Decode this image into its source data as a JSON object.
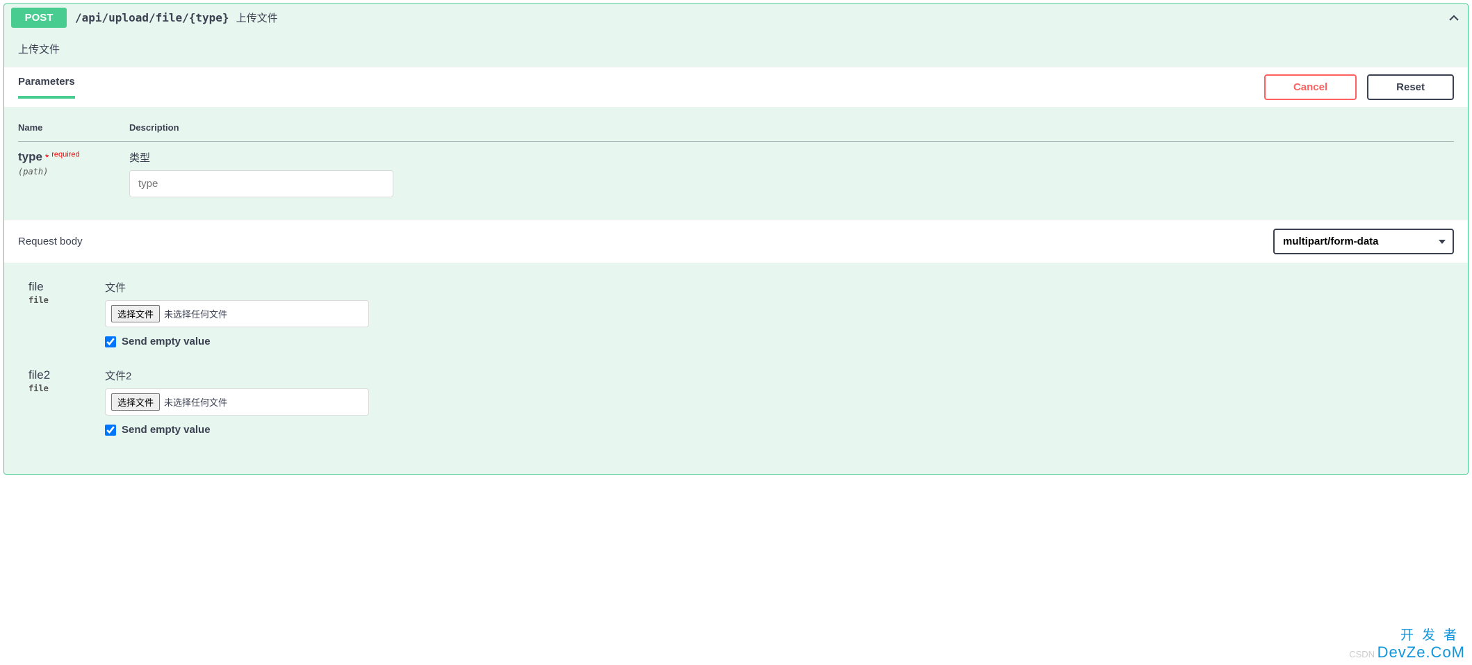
{
  "summary": {
    "method": "POST",
    "path": "/api/upload/file/{type}",
    "description": "上传文件"
  },
  "opblock_description": "上传文件",
  "parameters_tab": "Parameters",
  "buttons": {
    "cancel": "Cancel",
    "reset": "Reset"
  },
  "params_header": {
    "name": "Name",
    "description": "Description"
  },
  "params": [
    {
      "name": "type",
      "required_label": "required",
      "in": "(path)",
      "description": "类型",
      "placeholder": "type"
    }
  ],
  "request_body": {
    "title": "Request body",
    "content_type": "multipart/form-data"
  },
  "body_params": [
    {
      "name": "file",
      "type": "file",
      "description": "文件",
      "file_button": "选择文件",
      "file_status": "未选择任何文件",
      "send_empty_label": "Send empty value",
      "send_empty_checked": true
    },
    {
      "name": "file2",
      "type": "file",
      "description": "文件2",
      "file_button": "选择文件",
      "file_status": "未选择任何文件",
      "send_empty_label": "Send empty value",
      "send_empty_checked": true
    }
  ],
  "watermark": {
    "top": "开发者",
    "csdn": "CSDN ",
    "devze": "DevZe.CoM"
  }
}
